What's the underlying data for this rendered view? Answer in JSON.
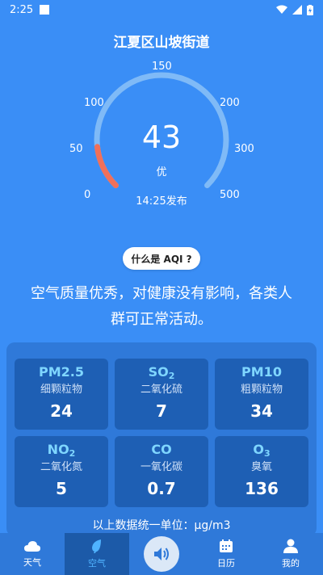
{
  "status_bar": {
    "time": "2:25"
  },
  "location": "江夏区山坡街道",
  "gauge": {
    "ticks": [
      "0",
      "50",
      "100",
      "150",
      "200",
      "300",
      "500"
    ],
    "value": "43",
    "aqi_number": 43,
    "level": "优",
    "publish_time": "14:25发布",
    "track_color": "#7fbaf7",
    "low_color": "#f0705a"
  },
  "aqi_help_label": "什么是 AQI ?",
  "advice": "空气质量优秀，对健康没有影响，各类人群可正常活动。",
  "pollutants": [
    {
      "name": "PM2.5",
      "sub": "",
      "desc": "细颗粒物",
      "value": "24"
    },
    {
      "name": "SO",
      "sub": "2",
      "desc": "二氧化硫",
      "value": "7"
    },
    {
      "name": "PM10",
      "sub": "",
      "desc": "粗颗粒物",
      "value": "34"
    },
    {
      "name": "NO",
      "sub": "2",
      "desc": "二氧化氮",
      "value": "5"
    },
    {
      "name": "CO",
      "sub": "",
      "desc": "一氧化碳",
      "value": "0.7"
    },
    {
      "name": "O",
      "sub": "3",
      "desc": "臭氧",
      "value": "136"
    }
  ],
  "unit_note": "以上数据统一单位：μg/m3",
  "tabs": [
    {
      "label": "天气",
      "icon": "cloud-icon"
    },
    {
      "label": "空气",
      "icon": "leaf-icon"
    },
    {
      "label": "",
      "icon": "speaker-icon"
    },
    {
      "label": "日历",
      "icon": "calendar-icon"
    },
    {
      "label": "我的",
      "icon": "user-icon"
    }
  ],
  "colors": {
    "background": "#3a8ef6",
    "panel": "#2f79d9",
    "card": "#1e5fb4",
    "pollutant_name": "#7fd6ff"
  }
}
